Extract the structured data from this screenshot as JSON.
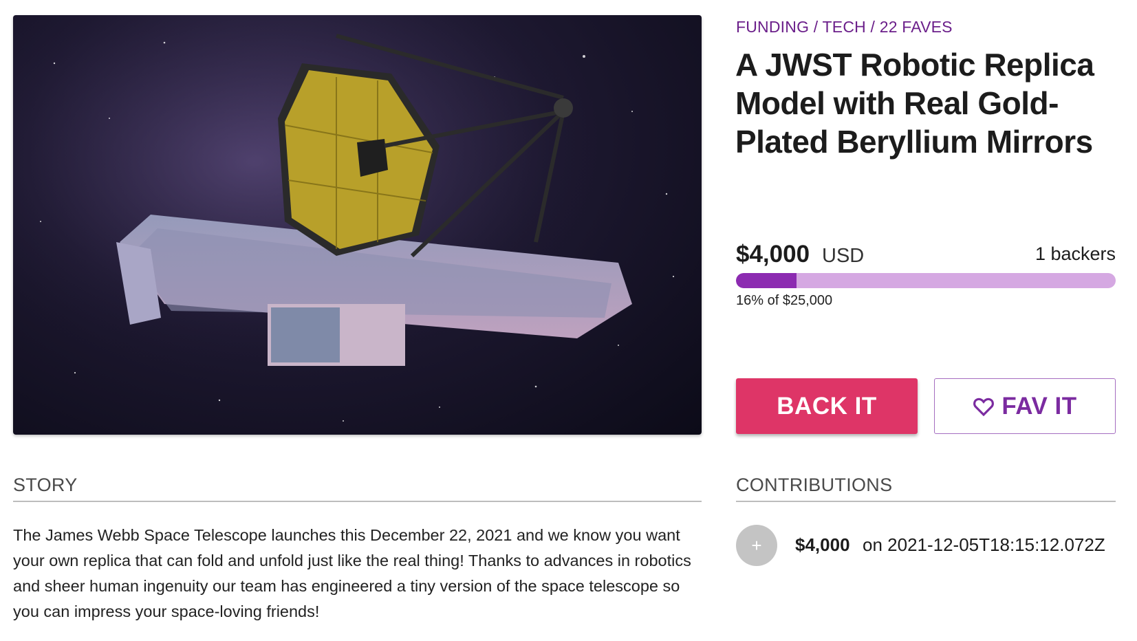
{
  "project": {
    "meta": "FUNDING / TECH / 22 FAVES",
    "title": "A JWST Robotic Replica Model with Real Gold-Plated Beryllium Mirrors",
    "image_icon": "jwst-telescope-image"
  },
  "funding": {
    "amount": "$4,000",
    "currency": "USD",
    "backers": "1 backers",
    "progress_fraction": 0.16,
    "progress_text": "16% of $25,000",
    "colors": {
      "fill": "#8c2bb1",
      "track": "#d5a8e2"
    }
  },
  "actions": {
    "back_label": "BACK IT",
    "fav_label": "FAV IT",
    "fav_icon": "heart-icon",
    "colors": {
      "back": "#de3567",
      "fav": "#7b2ba0"
    }
  },
  "story": {
    "heading": "STORY",
    "text": "The James Webb Space Telescope launches this December 22, 2021 and we know you want your own replica that can fold and unfold just like the real thing! Thanks to advances in robotics and sheer human ingenuity our team has engineered a tiny version of the space telescope so you can impress your space-loving friends!"
  },
  "contributions": {
    "heading": "CONTRIBUTIONS",
    "items": [
      {
        "avatar_icon": "plus-icon",
        "avatar_glyph": "+",
        "amount": "$4,000",
        "date": "on 2021-12-05T18:15:12.072Z"
      }
    ]
  }
}
